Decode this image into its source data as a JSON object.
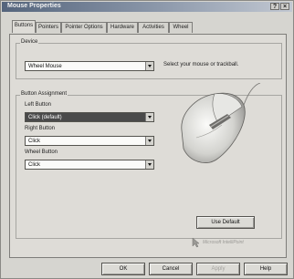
{
  "window": {
    "title": "Mouse Properties",
    "help_button": "?",
    "close_button": "×"
  },
  "tabs": [
    {
      "label": "Buttons",
      "active": true
    },
    {
      "label": "Pointers",
      "active": false
    },
    {
      "label": "Pointer Options",
      "active": false
    },
    {
      "label": "Hardware",
      "active": false
    },
    {
      "label": "Activities",
      "active": false
    },
    {
      "label": "Wheel",
      "active": false
    }
  ],
  "device": {
    "group_label": "Device",
    "selected": "Wheel Mouse",
    "hint": "Select your mouse or trackball."
  },
  "assignment": {
    "group_label": "Button Assignment",
    "left_label": "Left Button",
    "left_value": "Click (default)",
    "right_label": "Right Button",
    "right_value": "Click",
    "wheel_label": "Wheel Button",
    "wheel_value": "Click",
    "use_default_label": "Use Default"
  },
  "logo_text": "Microsoft IntelliPoint",
  "footer": {
    "ok_label": "OK",
    "cancel_label": "Cancel",
    "apply_label": "Apply",
    "help_label": "Help"
  }
}
